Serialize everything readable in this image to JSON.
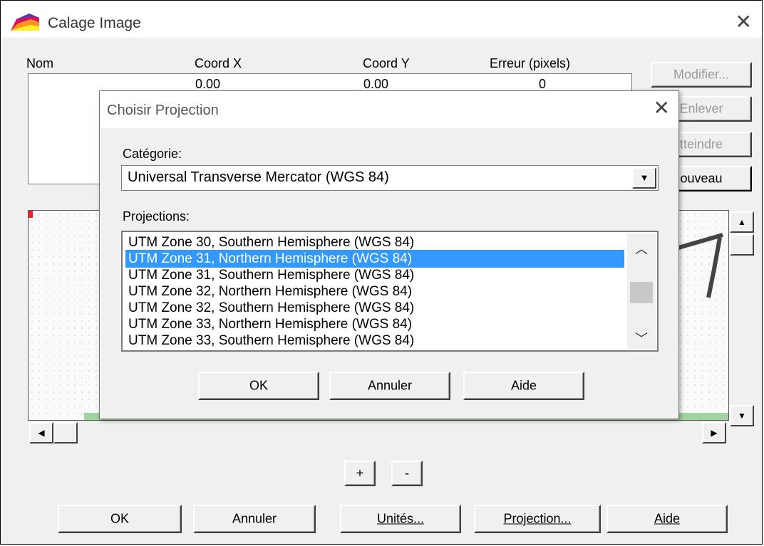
{
  "main_window": {
    "title": "Calage Image",
    "close_glyph": "✕",
    "columns": [
      "Nom",
      "Coord X",
      "Coord Y",
      "Erreur (pixels)"
    ],
    "gcp_row": {
      "x": "0.00",
      "y": "0.00",
      "error": "0"
    },
    "side_buttons": {
      "modify": "Modifier...",
      "remove": "Enlever",
      "reach": "tteindre",
      "new": "ouveau"
    },
    "zoom_in": "+",
    "zoom_out": "-",
    "bottom_buttons": {
      "ok": "OK",
      "cancel": "Annuler",
      "units": "Unités...",
      "projection": "Projection...",
      "help": "Aide"
    }
  },
  "dialog": {
    "title": "Choisir Projection",
    "close_glyph": "✕",
    "category_label": "Catégorie:",
    "category_value": "Universal Transverse Mercator (WGS 84)",
    "projections_label": "Projections:",
    "projections": [
      "UTM Zone 30, Southern Hemisphere (WGS 84)",
      "UTM Zone 31, Northern Hemisphere (WGS 84)",
      "UTM Zone 31, Southern Hemisphere (WGS 84)",
      "UTM Zone 32, Northern Hemisphere (WGS 84)",
      "UTM Zone 32, Southern Hemisphere (WGS 84)",
      "UTM Zone 33, Northern Hemisphere (WGS 84)",
      "UTM Zone 33, Southern Hemisphere (WGS 84)"
    ],
    "selected_index": 1,
    "buttons": {
      "ok": "OK",
      "cancel": "Annuler",
      "help": "Aide"
    }
  },
  "icons": {
    "app": "map-layers-icon",
    "close": "close-icon",
    "dropdown": "chevron-down-icon",
    "scroll_up": "arrow-up-icon",
    "scroll_down": "arrow-down-icon",
    "scroll_left": "arrow-left-icon",
    "scroll_right": "arrow-right-icon"
  },
  "colors": {
    "selection": "#3399ff",
    "window_bg": "#f0f0f0",
    "title_bg": "#ffffff"
  }
}
